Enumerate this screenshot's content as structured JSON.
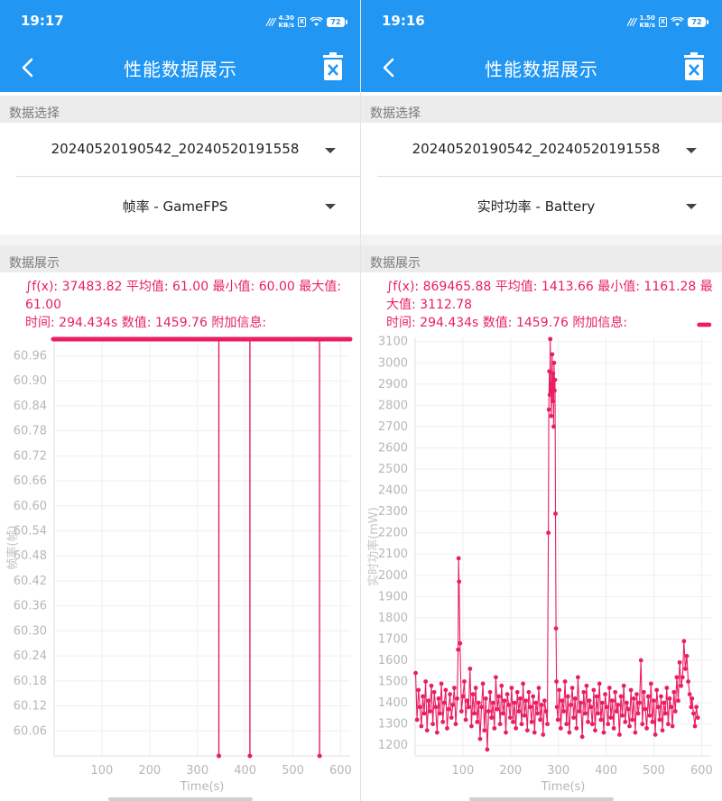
{
  "panels": [
    {
      "status_bar": {
        "time": "19:17",
        "net_speed_value": "4.30",
        "net_speed_unit": "KB/s",
        "sim_label": "X",
        "battery": "72"
      },
      "app_bar": {
        "title": "性能数据展示",
        "back_icon": "back-arrow-icon",
        "delete_icon": "trash-icon"
      },
      "data_select": {
        "header": "数据选择",
        "file_dropdown": {
          "value": "20240520190542_20240520191558"
        },
        "metric_dropdown": {
          "value": "帧率 - GameFPS"
        }
      },
      "data_display": {
        "header": "数据展示",
        "stats_line1": "∫f(x): 37483.82 平均值: 61.00 最小值: 60.00 最大值: 61.00",
        "stats_line2": "时间: 294.434s 数值: 1459.76 附加信息:"
      },
      "chart_data": {
        "type": "line",
        "ylabel": "帧率(帧)",
        "xlabel": "Time(s)",
        "xlim": [
          0,
          620
        ],
        "ylim": [
          60.0,
          61.0
        ],
        "xticks": [
          100,
          200,
          300,
          400,
          500,
          600
        ],
        "yticks": [
          "60.06",
          "60.12",
          "60.18",
          "60.24",
          "60.30",
          "60.36",
          "60.42",
          "60.48",
          "60.54",
          "60.60",
          "60.66",
          "60.72",
          "60.78",
          "60.84",
          "60.90",
          "60.96"
        ],
        "color": "#E91E63",
        "series": [
          {
            "x": [
              1,
              345,
              345,
              345,
              410,
              410,
              410,
              556,
              556,
              556,
              620
            ],
            "y": [
              61,
              61,
              60,
              61,
              61,
              60,
              61,
              61,
              60,
              61,
              61
            ]
          }
        ]
      }
    },
    {
      "status_bar": {
        "time": "19:16",
        "net_speed_value": "1.50",
        "net_speed_unit": "KB/s",
        "sim_label": "X",
        "battery": "72"
      },
      "app_bar": {
        "title": "性能数据展示",
        "back_icon": "back-arrow-icon",
        "delete_icon": "trash-icon"
      },
      "data_select": {
        "header": "数据选择",
        "file_dropdown": {
          "value": "20240520190542_20240520191558"
        },
        "metric_dropdown": {
          "value": "实时功率 - Battery"
        }
      },
      "data_display": {
        "header": "数据展示",
        "stats_line1": "∫f(x): 869465.88 平均值: 1413.66 最小值: 1161.28 最大值: 3112.78",
        "stats_line2": "时间: 294.434s 数值: 1459.76 附加信息:"
      },
      "chart_data": {
        "type": "line",
        "ylabel": "实时功率(mW)",
        "xlabel": "Time(s)",
        "xlim": [
          0,
          620
        ],
        "ylim": [
          1150,
          3120
        ],
        "xticks": [
          100,
          200,
          300,
          400,
          500,
          600
        ],
        "yticks": [
          "1200",
          "1300",
          "1400",
          "1500",
          "1600",
          "1700",
          "1800",
          "1900",
          "2000",
          "2100",
          "2200",
          "2300",
          "2400",
          "2500",
          "2600",
          "2700",
          "2800",
          "2900",
          "3000",
          "3100"
        ],
        "color": "#E91E63",
        "series": [
          {
            "x": [
              1,
              4,
              7,
              10,
              13,
              16,
              19,
              22,
              25,
              28,
              31,
              34,
              37,
              40,
              43,
              46,
              49,
              52,
              55,
              58,
              61,
              64,
              67,
              70,
              73,
              76,
              79,
              82,
              85,
              88,
              90,
              91,
              92,
              94,
              97,
              100,
              103,
              106,
              109,
              112,
              115,
              118,
              121,
              124,
              127,
              130,
              133,
              136,
              139,
              142,
              145,
              148,
              151,
              154,
              157,
              160,
              163,
              166,
              169,
              172,
              175,
              178,
              181,
              184,
              187,
              190,
              193,
              196,
              199,
              202,
              205,
              208,
              211,
              214,
              217,
              220,
              223,
              226,
              229,
              232,
              235,
              238,
              241,
              244,
              247,
              250,
              253,
              256,
              259,
              262,
              265,
              268,
              271,
              274,
              277,
              279,
              280,
              281,
              282,
              283,
              284,
              285,
              286,
              287,
              288,
              289,
              290,
              291,
              292,
              293,
              294,
              295,
              296,
              297,
              299,
              302,
              305,
              308,
              311,
              314,
              317,
              320,
              323,
              326,
              329,
              332,
              335,
              338,
              341,
              344,
              347,
              350,
              353,
              356,
              359,
              362,
              365,
              368,
              371,
              374,
              377,
              380,
              383,
              386,
              389,
              392,
              395,
              398,
              401,
              404,
              407,
              410,
              413,
              416,
              419,
              422,
              425,
              428,
              431,
              434,
              437,
              440,
              443,
              446,
              449,
              452,
              455,
              458,
              461,
              464,
              467,
              470,
              473,
              476,
              479,
              482,
              485,
              488,
              491,
              494,
              497,
              500,
              503,
              506,
              509,
              512,
              515,
              518,
              521,
              524,
              527,
              530,
              533,
              536,
              539,
              542,
              545,
              548,
              551,
              554,
              557,
              560,
              563,
              566,
              569,
              572,
              575,
              578,
              580,
              583,
              586,
              589,
              592,
              595,
              598,
              601,
              604,
              607,
              610,
              613,
              616
            ],
            "y": [
              1540,
              1320,
              1460,
              1380,
              1290,
              1430,
              1350,
              1500,
              1270,
              1410,
              1360,
              1480,
              1300,
              1450,
              1380,
              1260,
              1420,
              1350,
              1490,
              1310,
              1400,
              1460,
              1280,
              1370,
              1440,
              1330,
              1390,
              1470,
              1300,
              1420,
              1650,
              2080,
              1970,
              1680,
              1360,
              1430,
              1500,
              1320,
              1410,
              1380,
              1560,
              1290,
              1440,
              1350,
              1470,
              1310,
              1400,
              1230,
              1380,
              1490,
              1270,
              1420,
              1180,
              1360,
              1450,
              1330,
              1400,
              1280,
              1520,
              1370,
              1430,
              1300,
              1480,
              1350,
              1410,
              1260,
              1440,
              1390,
              1330,
              1470,
              1310,
              1400,
              1280,
              1450,
              1360,
              1420,
              1300,
              1490,
              1340,
              1410,
              1270,
              1450,
              1380,
              1310,
              1430,
              1260,
              1400,
              1350,
              1470,
              1320,
              1390,
              1250,
              1410,
              1360,
              1300,
              2200,
              2780,
              2960,
              2850,
              3112,
              2900,
              2750,
              2880,
              3040,
              2820,
              2950,
              2700,
              3000,
              2870,
              2920,
              2290,
              1750,
              1500,
              1380,
              1320,
              1460,
              1280,
              1410,
              1360,
              1500,
              1300,
              1430,
              1260,
              1390,
              1470,
              1330,
              1420,
              1280,
              1520,
              1360,
              1400,
              1240,
              1450,
              1350,
              1480,
              1310,
              1410,
              1380,
              1300,
              1460,
              1270,
              1430,
              1350,
              1490,
              1320,
              1400,
              1260,
              1440,
              1380,
              1300,
              1470,
              1330,
              1410,
              1280,
              1450,
              1360,
              1390,
              1250,
              1430,
              1340,
              1480,
              1310,
              1400,
              1370,
              1290,
              1460,
              1320,
              1420,
              1260,
              1440,
              1350,
              1400,
              1600,
              1300,
              1450,
              1370,
              1280,
              1430,
              1340,
              1490,
              1310,
              1410,
              1250,
              1460,
              1380,
              1320,
              1430,
              1270,
              1400,
              1350,
              1470,
              1300,
              1420,
              1380,
              1290,
              1450,
              1360,
              1520,
              1410,
              1590,
              1480,
              1520,
              1690,
              1560,
              1620,
              1500,
              1440,
              1380,
              1420,
              1350,
              1290,
              1380,
              1330
            ]
          }
        ]
      }
    }
  ]
}
